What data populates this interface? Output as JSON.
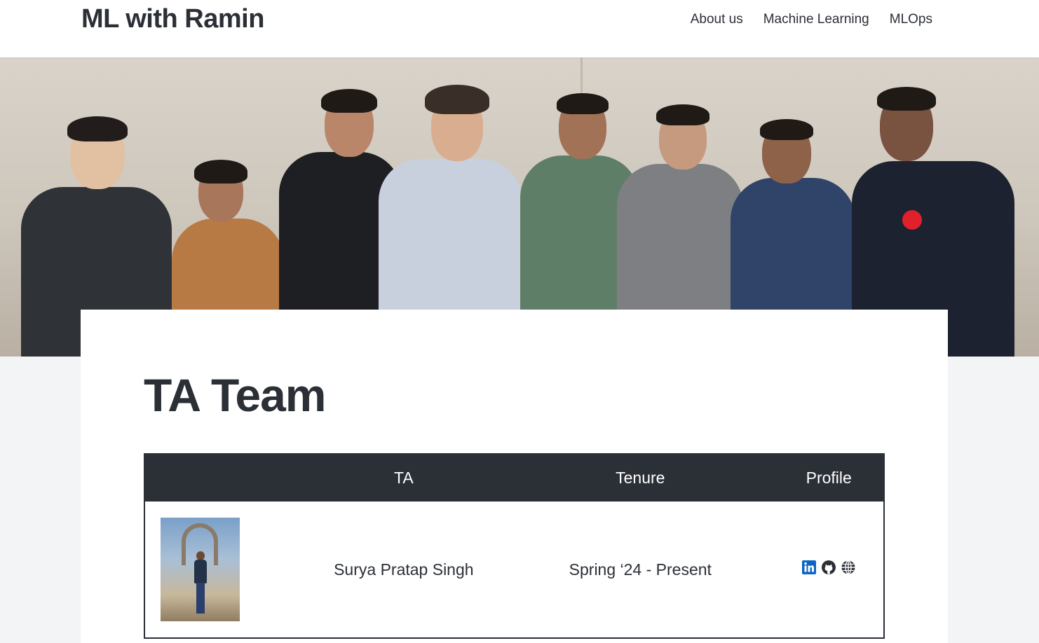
{
  "navbar": {
    "brand": "ML with Ramin",
    "links": [
      {
        "label": "About us"
      },
      {
        "label": "Machine Learning"
      },
      {
        "label": "MLOps"
      }
    ]
  },
  "page": {
    "title": "TA Team"
  },
  "table": {
    "headers": {
      "photo": "",
      "ta": "TA",
      "tenure": "Tenure",
      "profile": "Profile"
    },
    "rows": [
      {
        "name": "Surya Pratap Singh",
        "tenure": "Spring ‘24 - Present",
        "profile_icons": [
          "linkedin-icon",
          "github-icon",
          "globe-icon"
        ]
      }
    ]
  },
  "colors": {
    "dark": "#2b2f36",
    "linkedin": "#0a66c2",
    "background": "#f3f4f6"
  }
}
